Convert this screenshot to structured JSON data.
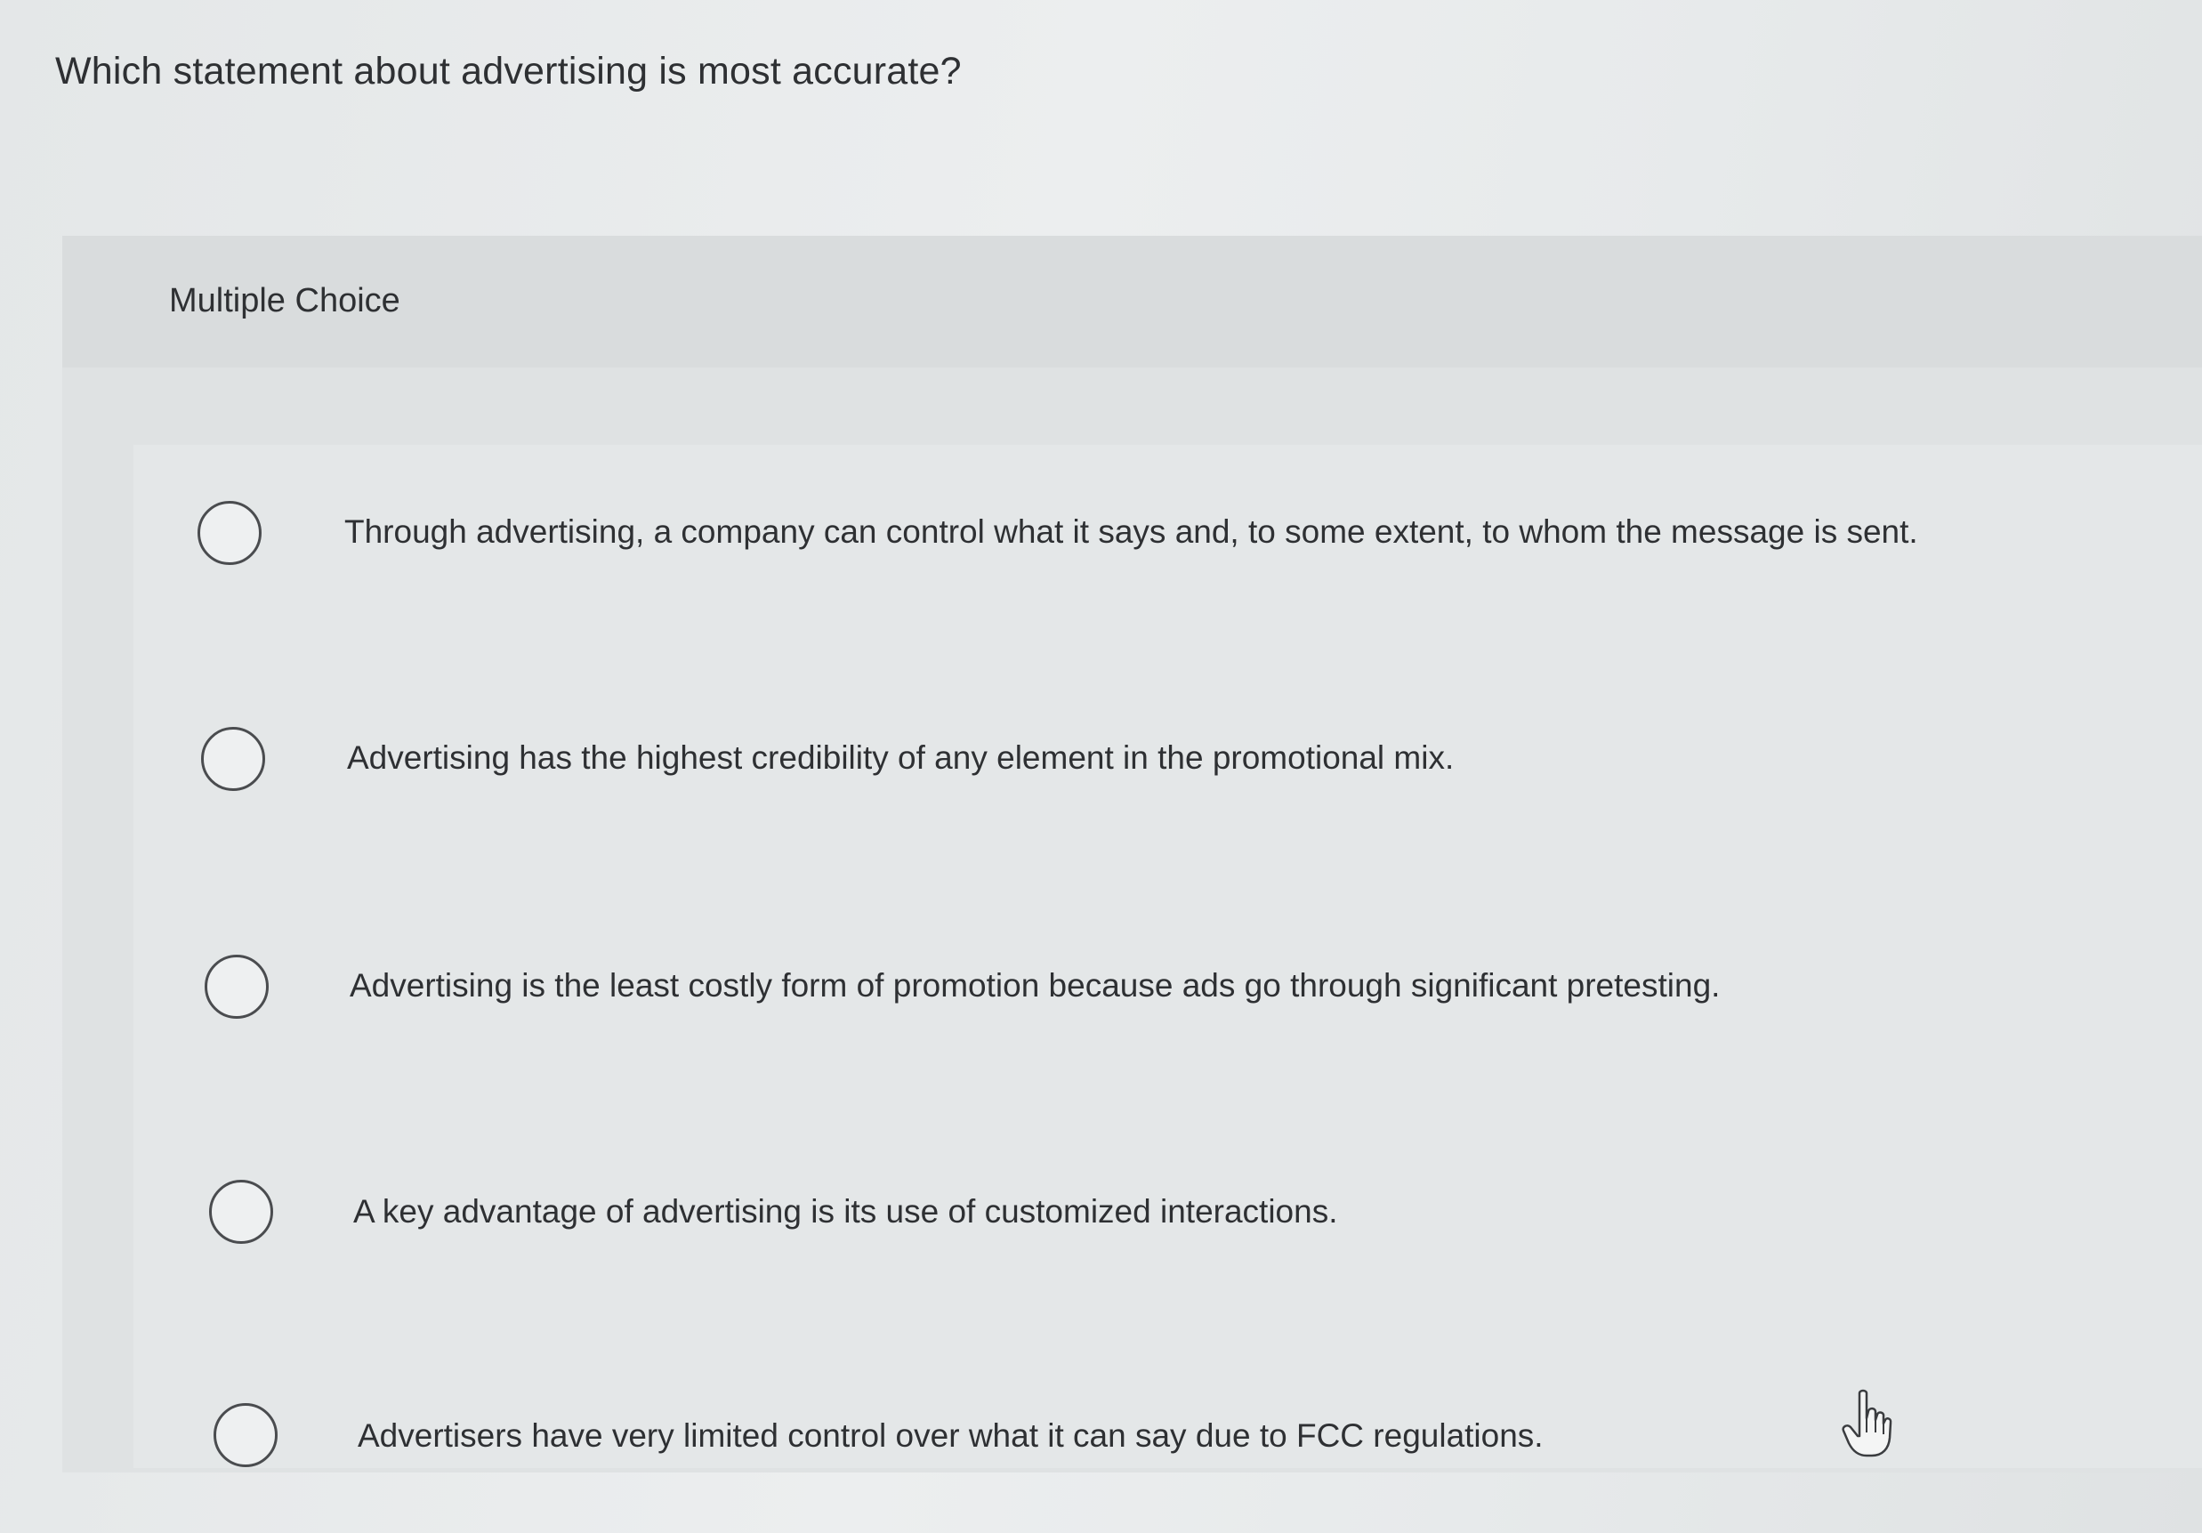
{
  "question": {
    "text": "Which statement about advertising is most accurate?"
  },
  "choice_section": {
    "header_label": "Multiple Choice"
  },
  "options": [
    {
      "text": "Through advertising, a company can control what it says and, to some extent, to whom the message is sent."
    },
    {
      "text": "Advertising has the highest credibility of any element in the promotional mix."
    },
    {
      "text": "Advertising is the least costly form of promotion because ads go through significant pretesting."
    },
    {
      "text": "A key advantage of advertising is its use of customized interactions."
    },
    {
      "text": "Advertisers have very limited control over what it can say due to FCC regulations."
    }
  ],
  "icons": {
    "radio": "radio-button-icon",
    "cursor": "hand-pointer-icon"
  },
  "colors": {
    "background": "#e6e9ea",
    "text": "#2e3033",
    "radio_border": "#4a4c4f"
  }
}
